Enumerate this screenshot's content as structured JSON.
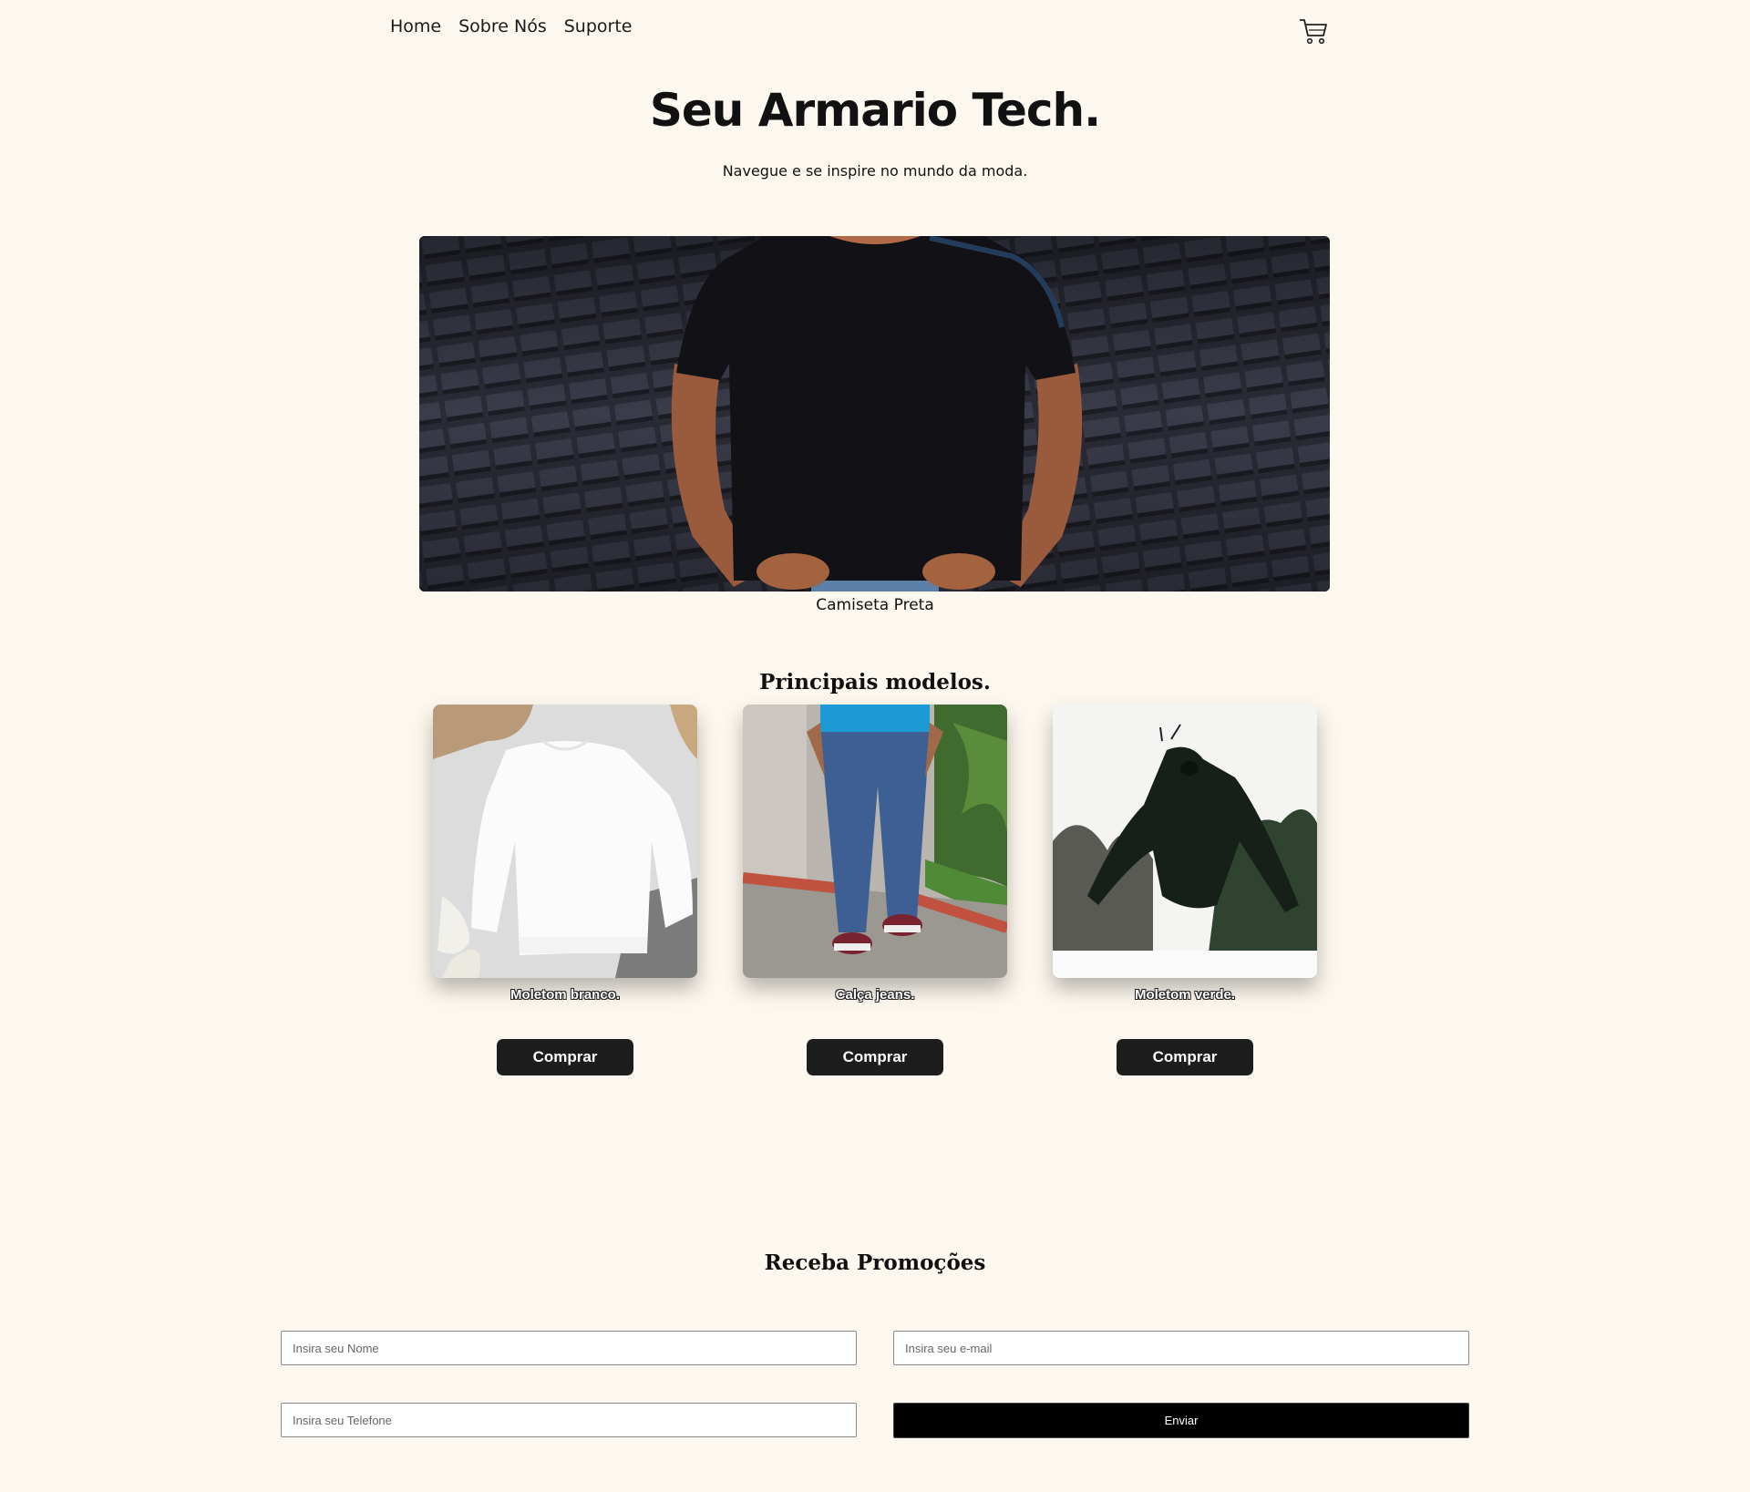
{
  "nav": {
    "items": [
      {
        "label": "Home"
      },
      {
        "label": "Sobre Nós"
      },
      {
        "label": "Suporte"
      }
    ],
    "cart_icon": "shopping-cart-icon"
  },
  "hero": {
    "title": "Seu Armario Tech.",
    "subtitle": "Navegue e se inspire no mundo da moda.",
    "image_caption": "Camiseta Preta"
  },
  "models": {
    "heading": "Principais modelos.",
    "items": [
      {
        "label": "Moletom branco.",
        "button": "Comprar"
      },
      {
        "label": "Calça jeans.",
        "button": "Comprar"
      },
      {
        "label": "Moletom verde.",
        "button": "Comprar"
      }
    ]
  },
  "promo": {
    "heading": "Receba Promoções",
    "name_placeholder": "Insira seu Nome",
    "email_placeholder": "Insira seu e-mail",
    "phone_placeholder": "Insira seu Telefone",
    "submit": "Enviar"
  },
  "colors": {
    "background": "#fdf8ef",
    "button": "#1d1d1d",
    "submit": "#000000"
  }
}
